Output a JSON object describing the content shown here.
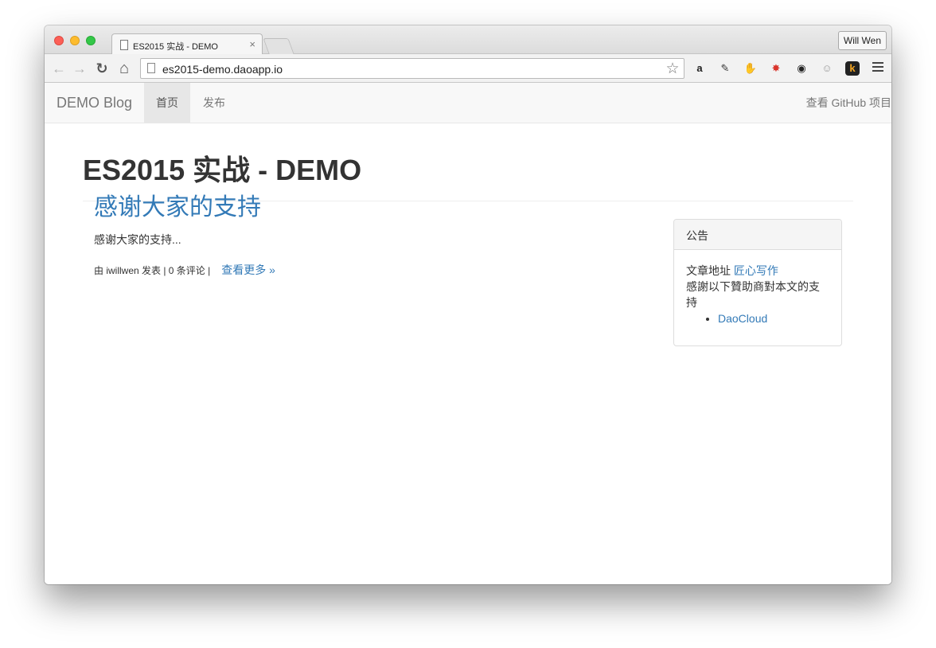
{
  "browser": {
    "tab_title": "ES2015 实战 - DEMO",
    "tab_close_glyph": "×",
    "profile_name": "Will Wen",
    "url": "es2015-demo.daoapp.io",
    "back_glyph": "←",
    "forward_glyph": "→",
    "reload_glyph": "↻",
    "home_glyph": "⌂",
    "star_glyph": "☆",
    "extensions": [
      {
        "name": "amazon-icon",
        "glyph": "a",
        "color": "#222222",
        "bg": "transparent"
      },
      {
        "name": "pen-icon",
        "glyph": "✎",
        "color": "#333333",
        "bg": "transparent"
      },
      {
        "name": "evernote-icon",
        "glyph": "✋",
        "color": "#444444",
        "bg": "transparent"
      },
      {
        "name": "burst-icon",
        "glyph": "✸",
        "color": "#d9342b",
        "bg": "transparent"
      },
      {
        "name": "color-wheel-icon",
        "glyph": "◉",
        "color": "#222222",
        "bg": "transparent"
      },
      {
        "name": "ghost-icon",
        "glyph": "☺",
        "color": "#9a9a9a",
        "bg": "transparent"
      },
      {
        "name": "k-icon",
        "glyph": "k",
        "color": "#f5a623",
        "bg": "#222222"
      }
    ]
  },
  "navbar": {
    "brand": "DEMO Blog",
    "items": [
      {
        "label": "首页",
        "active": true
      },
      {
        "label": "发布",
        "active": false
      }
    ],
    "github_link": "查看 GitHub 项目"
  },
  "page": {
    "title": "ES2015 实战 - DEMO"
  },
  "post": {
    "title": "感谢大家的支持",
    "excerpt": "感谢大家的支持...",
    "meta": "由 iwillwen 发表 | 0 条评论 |",
    "more": "查看更多 »"
  },
  "sidebar": {
    "heading": "公告",
    "line1_prefix": "文章地址 ",
    "line1_link": "匠心写作",
    "line2": "感謝以下贊助商對本文的支持",
    "sponsors": [
      "DaoCloud"
    ]
  },
  "colors": {
    "link": "#337ab7",
    "navbar_bg": "#f8f8f8",
    "active_nav": "#e7e7e7"
  }
}
